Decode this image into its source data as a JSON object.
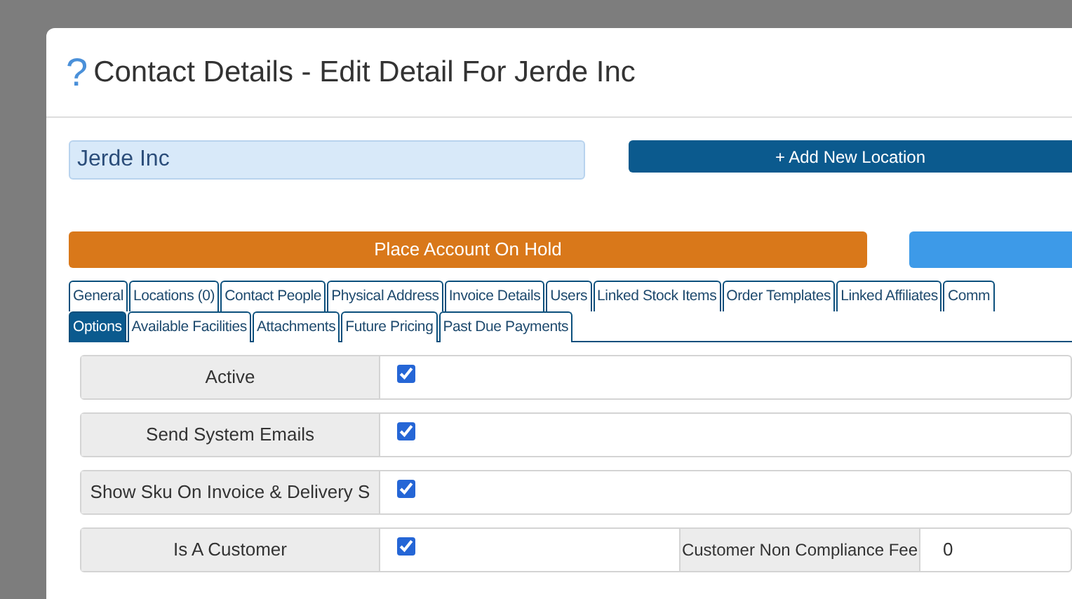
{
  "dialog": {
    "help_glyph": "?",
    "title": "Contact Details - Edit Detail For Jerde Inc"
  },
  "name_field": {
    "value": "Jerde Inc"
  },
  "add_location_button": {
    "label": "+ Add New Location"
  },
  "hold_button": {
    "label": "Place Account On Hold"
  },
  "tab_rows": [
    [
      {
        "label": "General",
        "selected": false
      },
      {
        "label": "Locations (0)",
        "selected": false
      },
      {
        "label": "Contact People",
        "selected": false
      },
      {
        "label": "Physical Address",
        "selected": false
      },
      {
        "label": "Invoice Details",
        "selected": false
      },
      {
        "label": "Users",
        "selected": false
      },
      {
        "label": "Linked Stock Items",
        "selected": false
      },
      {
        "label": "Order Templates",
        "selected": false
      },
      {
        "label": "Linked Affiliates",
        "selected": false
      },
      {
        "label": "Comm",
        "selected": false
      }
    ],
    [
      {
        "label": "Options",
        "selected": true
      },
      {
        "label": "Available Facilities",
        "selected": false
      },
      {
        "label": "Attachments",
        "selected": false
      },
      {
        "label": "Future Pricing",
        "selected": false
      },
      {
        "label": "Past Due Payments",
        "selected": false
      }
    ]
  ],
  "settings": [
    {
      "label": "Active",
      "checked": true
    },
    {
      "label": "Send System Emails",
      "checked": true
    },
    {
      "label": "Show Sku On Invoice & Delivery S",
      "checked": true
    },
    {
      "label": "Is A Customer",
      "checked": true,
      "extra_label": "Customer Non Compliance Fee",
      "extra_value": "0"
    }
  ]
}
